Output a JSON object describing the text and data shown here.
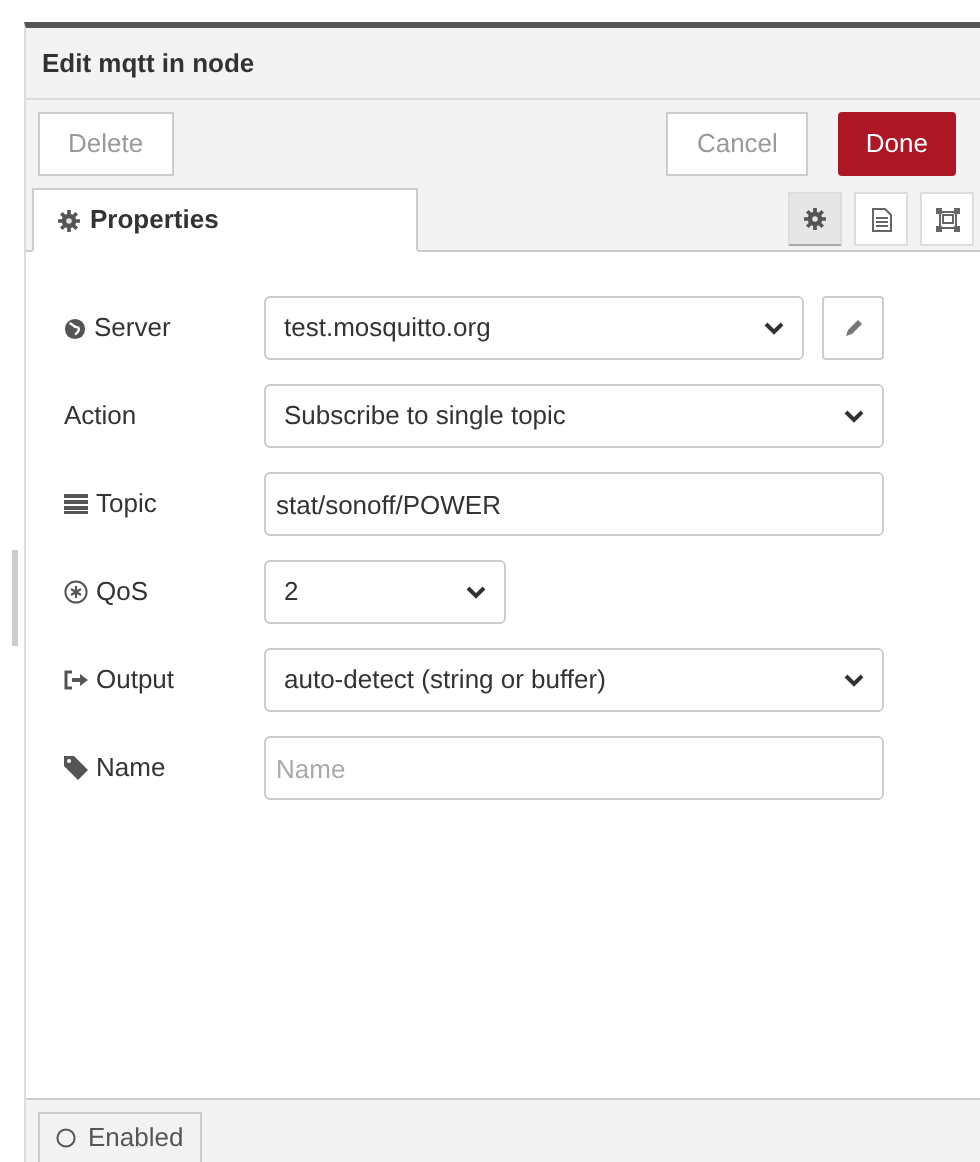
{
  "dialog": {
    "title": "Edit mqtt in node"
  },
  "toolbar": {
    "delete": "Delete",
    "cancel": "Cancel",
    "done": "Done"
  },
  "tabs": [
    {
      "label": "Properties",
      "selected": true
    }
  ],
  "tab_tools": [
    {
      "kind": "gear",
      "selected": true
    },
    {
      "kind": "doc",
      "selected": false
    },
    {
      "kind": "frame",
      "selected": false
    }
  ],
  "fields": [
    {
      "label": "Server",
      "kind": "select",
      "value": "test.mosquitto.org"
    },
    {
      "label": "Action",
      "kind": "select",
      "value": "Subscribe to single topic"
    },
    {
      "label": "Topic",
      "kind": "input",
      "value": "stat/sonoff/POWER"
    },
    {
      "label": "QoS",
      "kind": "select",
      "value": "2"
    },
    {
      "label": "Output",
      "kind": "select",
      "value": "auto-detect (string or buffer)"
    },
    {
      "label": "Name",
      "kind": "input",
      "placeholder": "Name"
    }
  ],
  "footer": {
    "enabled_label": "Enabled"
  }
}
